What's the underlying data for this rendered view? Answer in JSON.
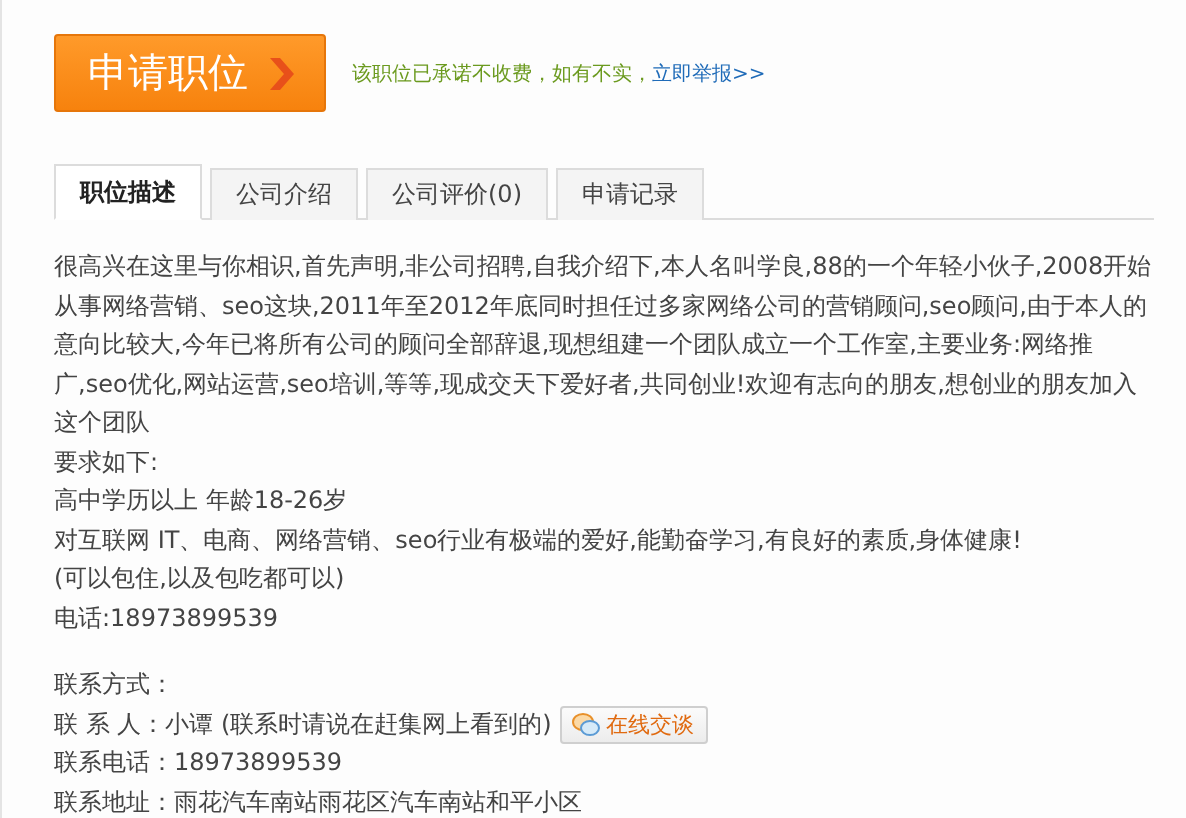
{
  "apply_button": {
    "label": "申请职位"
  },
  "notice": {
    "text": "该职位已承诺不收费，如有不实，",
    "link": "立即举报>>"
  },
  "tabs": [
    {
      "label": "职位描述",
      "selected": true
    },
    {
      "label": "公司介绍",
      "selected": false
    },
    {
      "label": "公司评价(0)",
      "selected": false
    },
    {
      "label": "申请记录",
      "selected": false
    }
  ],
  "description": [
    "很高兴在这里与你相识,首先声明,非公司招聘,自我介绍下,本人名叫学良,88的一个年轻小伙子,2008开始从事网络营销、seo这块,2011年至2012年底同时担任过多家网络公司的营销顾问,seo顾问,由于本人的意向比较大,今年已将所有公司的顾问全部辞退,现想组建一个团队成立一个工作室,主要业务:网络推广,seo优化,网站运营,seo培训,等等,现成交天下爱好者,共同创业!欢迎有志向的朋友,想创业的朋友加入这个团队",
    "要求如下:",
    "高中学历以上 年龄18-26岁",
    "对互联网 IT、电商、网络营销、seo行业有极端的爱好,能勤奋学习,有良好的素质,身体健康!",
    "(可以包住,以及包吃都可以)",
    "电话:18973899539"
  ],
  "contact": {
    "heading": "联系方式：",
    "rows": [
      {
        "label": "联 系 人：",
        "value": "小谭 (联系时请说在赶集网上看到的)",
        "chat_button": "在线交谈"
      },
      {
        "label": "联系电话：",
        "value": "18973899539"
      },
      {
        "label": "联系地址：",
        "value": "雨花汽车南站雨花区汽车南站和平小区"
      }
    ]
  }
}
